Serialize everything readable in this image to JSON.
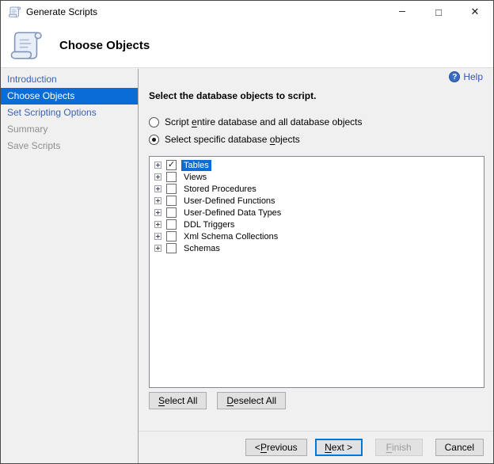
{
  "window": {
    "title": "Generate Scripts",
    "controls": [
      {
        "name": "minimize",
        "glyph": "–"
      },
      {
        "name": "maximize",
        "glyph": "□"
      },
      {
        "name": "close",
        "glyph": "✕"
      }
    ]
  },
  "header": {
    "title": "Choose Objects",
    "icon": "script-scroll-icon"
  },
  "sidebar": {
    "items": [
      {
        "label": "Introduction",
        "state": "link"
      },
      {
        "label": "Choose Objects",
        "state": "selected"
      },
      {
        "label": "Set Scripting Options",
        "state": "link"
      },
      {
        "label": "Summary",
        "state": "disabled"
      },
      {
        "label": "Save Scripts",
        "state": "disabled"
      }
    ]
  },
  "help": {
    "label": "Help",
    "icon": "help-icon",
    "icon_glyph": "?"
  },
  "main": {
    "heading": "Select the database objects to script.",
    "radios": [
      {
        "label": "Script entire database and all database objects",
        "underline_index": 7,
        "selected": false
      },
      {
        "label": "Select specific database objects",
        "underline_index": 25,
        "selected": true
      }
    ],
    "tree": {
      "items": [
        {
          "label": "Tables",
          "checked": true,
          "highlighted": true
        },
        {
          "label": "Views",
          "checked": false,
          "highlighted": false
        },
        {
          "label": "Stored Procedures",
          "checked": false,
          "highlighted": false
        },
        {
          "label": "User-Defined Functions",
          "checked": false,
          "highlighted": false
        },
        {
          "label": "User-Defined Data Types",
          "checked": false,
          "highlighted": false
        },
        {
          "label": "DDL Triggers",
          "checked": false,
          "highlighted": false
        },
        {
          "label": "Xml Schema Collections",
          "checked": false,
          "highlighted": false
        },
        {
          "label": "Schemas",
          "checked": false,
          "highlighted": false
        }
      ]
    },
    "list_buttons": [
      {
        "label": "Select All",
        "underline_index": 0
      },
      {
        "label": "Deselect All",
        "underline_index": 0
      }
    ]
  },
  "footer": {
    "buttons": [
      {
        "label": "< Previous",
        "underline_index": 2,
        "state": "normal"
      },
      {
        "label": "Next >",
        "underline_index": 0,
        "state": "default"
      },
      {
        "label": "Finish",
        "underline_index": 0,
        "state": "disabled"
      },
      {
        "label": "Cancel",
        "underline_index": -1,
        "state": "normal"
      }
    ]
  },
  "colors": {
    "accent_blue": "#0a6cd6",
    "link_blue": "#3a62b0",
    "disabled_gray": "#8f8f8f",
    "body_background": "#f0f0f0",
    "panel_white": "#ffffff",
    "button_face": "#e1e1e1"
  }
}
